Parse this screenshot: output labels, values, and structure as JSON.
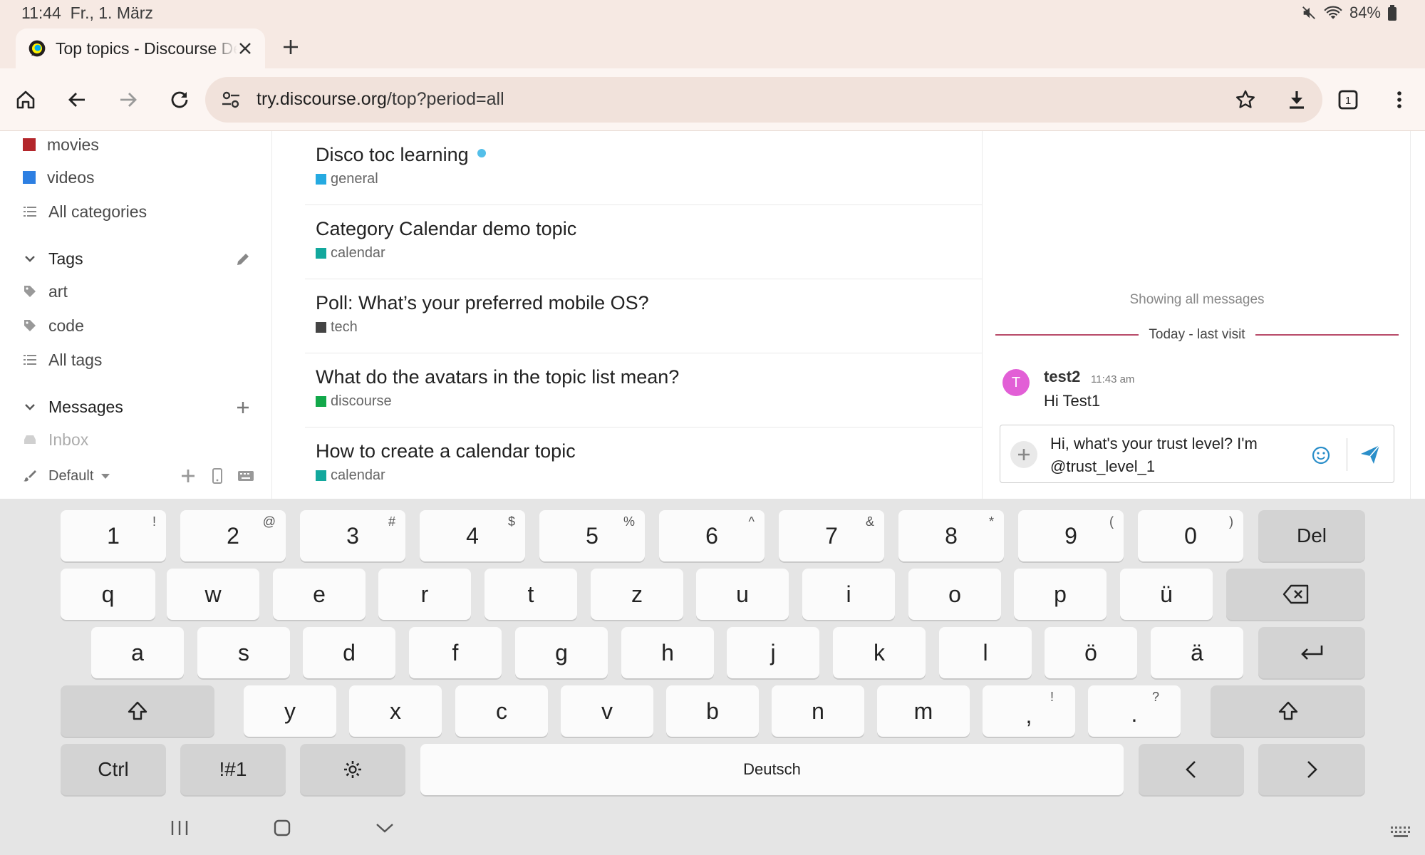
{
  "status": {
    "time": "11:44",
    "date": "Fr., 1. März",
    "battery": "84%"
  },
  "tab": {
    "title": "Top topics - Discourse Demo"
  },
  "url": {
    "host": "try.discourse.org",
    "path": "/top?period=all"
  },
  "sidebar": {
    "categories": [
      {
        "label": "movies",
        "color": "#b3262b"
      },
      {
        "label": "videos",
        "color": "#2d7fe2"
      }
    ],
    "all_categories": "All categories",
    "tags_heading": "Tags",
    "tags": [
      {
        "label": "art"
      },
      {
        "label": "code"
      }
    ],
    "all_tags": "All tags",
    "messages_heading": "Messages",
    "inbox": "Inbox",
    "theme": "Default"
  },
  "topics": [
    {
      "title": "Disco toc learning",
      "category": "general",
      "color": "#25aae1",
      "unread": true
    },
    {
      "title": "Category Calendar demo topic",
      "category": "calendar",
      "color": "#12a89d"
    },
    {
      "title": "Poll: What’s your preferred mobile OS?",
      "category": "tech",
      "color": "#444444"
    },
    {
      "title": "What do the avatars in the topic list mean?",
      "category": "discourse",
      "color": "#12a84a"
    },
    {
      "title": "How to create a calendar topic",
      "category": "calendar",
      "color": "#12a89d"
    }
  ],
  "chat": {
    "showing": "Showing all messages",
    "divider": "Today - last visit",
    "avatar_letter": "T",
    "username": "test2",
    "time": "11:43 am",
    "message": "Hi Test1",
    "draft_line1": "Hi, what's your trust level? I'm",
    "draft_line2": "@trust_level_1"
  },
  "keyboard": {
    "numbers": [
      {
        "k": "1",
        "a": "!"
      },
      {
        "k": "2",
        "a": "@"
      },
      {
        "k": "3",
        "a": "#"
      },
      {
        "k": "4",
        "a": "$"
      },
      {
        "k": "5",
        "a": "%"
      },
      {
        "k": "6",
        "a": "^"
      },
      {
        "k": "7",
        "a": "&"
      },
      {
        "k": "8",
        "a": "*"
      },
      {
        "k": "9",
        "a": "("
      },
      {
        "k": "0",
        "a": ")"
      }
    ],
    "del": "Del",
    "row_q": [
      "q",
      "w",
      "e",
      "r",
      "t",
      "z",
      "u",
      "i",
      "o",
      "p",
      "ü"
    ],
    "row_a": [
      "a",
      "s",
      "d",
      "f",
      "g",
      "h",
      "j",
      "k",
      "l",
      "ö",
      "ä"
    ],
    "row_y": [
      "y",
      "x",
      "c",
      "v",
      "b",
      "n",
      "m"
    ],
    "comma": ",",
    "comma_alt": "!",
    "period": ".",
    "period_alt": "?",
    "ctrl": "Ctrl",
    "symbols": "!#1",
    "space": "Deutsch"
  }
}
